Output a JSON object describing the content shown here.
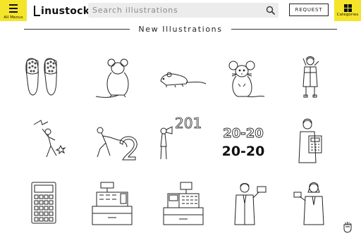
{
  "header": {
    "menu_label": "All Menus",
    "logo_text": "inustock",
    "search_placeholder": "Search illustrations",
    "request_label": "REQUEST",
    "categories_label": "Categories"
  },
  "section": {
    "title": "New Illustrations"
  },
  "icons": {
    "menu": "hamburger-icon",
    "search": "search-icon",
    "categories": "grid-icon",
    "scroll": "fist-icon"
  },
  "colors": {
    "accent": "#f4e52a",
    "search_bg": "#ececec",
    "line": "#222222"
  },
  "illustrations": [
    {
      "name": "sandals"
    },
    {
      "name": "rat-back-view"
    },
    {
      "name": "mouse-side"
    },
    {
      "name": "rat-front"
    },
    {
      "name": "woman-winter-coat"
    },
    {
      "name": "man-throwing"
    },
    {
      "name": "man-pulling-number-2"
    },
    {
      "name": "man-megaphone-201"
    },
    {
      "name": "text-2020",
      "texts": [
        "20-20",
        "20-20"
      ]
    },
    {
      "name": "woman-with-calculator"
    },
    {
      "name": "calculator"
    },
    {
      "name": "cash-register"
    },
    {
      "name": "pos-register"
    },
    {
      "name": "businessman-with-card"
    },
    {
      "name": "businesswoman-with-card"
    }
  ],
  "megaphone_text": "201"
}
